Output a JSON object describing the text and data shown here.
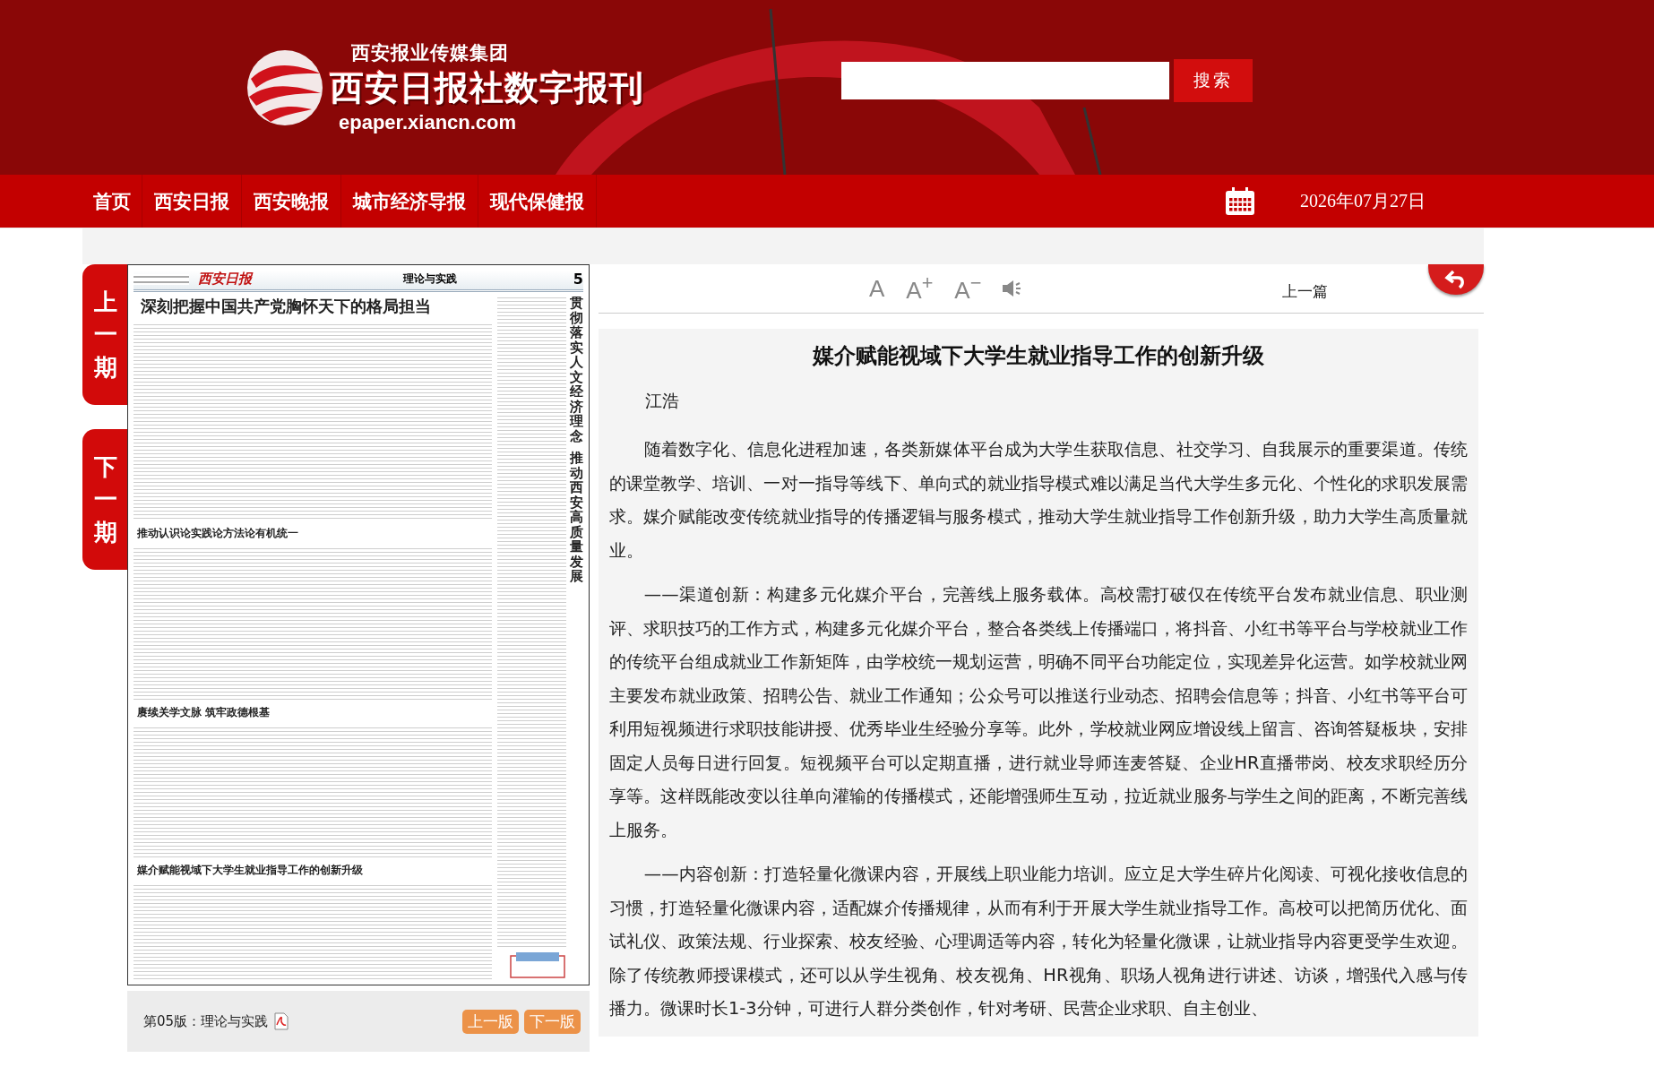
{
  "header": {
    "group_name": "西安报业传媒集团",
    "site_title": "西安日报社数字报刊",
    "domain": "epaper.xiancn.com",
    "search": {
      "button": "搜索"
    }
  },
  "nav": {
    "items": [
      "首页",
      "西安日报",
      "西安晚报",
      "城市经济导报",
      "现代保健报"
    ],
    "date": "2026年07月27日"
  },
  "side_tabs": [
    "上一期",
    "下一期"
  ],
  "newspaper": {
    "masthead": "西安日报",
    "section": "理论与实践",
    "page_number": "5",
    "headlines": [
      "深刻把握中国共产党胸怀天下的格局担当",
      "推动认识论实践论方法论有机统一",
      "赓续关学文脉  筑牢政德根基",
      "媒介赋能视域下大学生就业指导工作的创新升级"
    ],
    "vertical_title": [
      "贯彻落实人文经济理念",
      "推动西安高质量发展"
    ]
  },
  "page_footer": {
    "label": "第05版：理论与实践",
    "buttons": [
      "上一版",
      "下一版"
    ]
  },
  "toolbar": {
    "font_buttons": [
      "A",
      "A$^{+}$",
      "A$^{−}$"
    ],
    "prev_article": "上一篇"
  },
  "article": {
    "title": "媒介赋能视域下大学生就业指导工作的创新升级",
    "author": "江浩",
    "paragraphs": [
      "随着数字化、信息化进程加速，各类新媒体平台成为大学生获取信息、社交学习、自我展示的重要渠道。传统的课堂教学、培训、一对一指导等线下、单向式的就业指导模式难以满足当代大学生多元化、个性化的求职发展需求。媒介赋能改变传统就业指导的传播逻辑与服务模式，推动大学生就业指导工作创新升级，助力大学生高质量就业。",
      "——渠道创新：构建多元化媒介平台，完善线上服务载体。高校需打破仅在传统平台发布就业信息、职业测评、求职技巧的工作方式，构建多元化媒介平台，整合各类线上传播端口，将抖音、小红书等平台与学校就业工作的传统平台组成就业工作新矩阵，由学校统一规划运营，明确不同平台功能定位，实现差异化运营。如学校就业网主要发布就业政策、招聘公告、就业工作通知；公众号可以推送行业动态、招聘会信息等；抖音、小红书等平台可利用短视频进行求职技能讲授、优秀毕业生经验分享等。此外，学校就业网应增设线上留言、咨询答疑板块，安排固定人员每日进行回复。短视频平台可以定期直播，进行就业导师连麦答疑、企业HR直播带岗、校友求职经历分享等。这样既能改变以往单向灌输的传播模式，还能增强师生互动，拉近就业服务与学生之间的距离，不断完善线上服务。",
      "——内容创新：打造轻量化微课内容，开展线上职业能力培训。应立足大学生碎片化阅读、可视化接收信息的习惯，打造轻量化微课内容，适配媒介传播规律，从而有利于开展大学生就业指导工作。高校可以把简历优化、面试礼仪、政策法规、行业探索、校友经验、心理调适等内容，转化为轻量化微课，让就业指导内容更受学生欢迎。除了传统教师授课模式，还可以从学生视角、校友视角、HR视角、职场人视角进行讲述、访谈，增强代入感与传播力。微课时长1-3分钟，可进行人群分类创作，针对考研、民营企业求职、自主创业、"
    ]
  }
}
